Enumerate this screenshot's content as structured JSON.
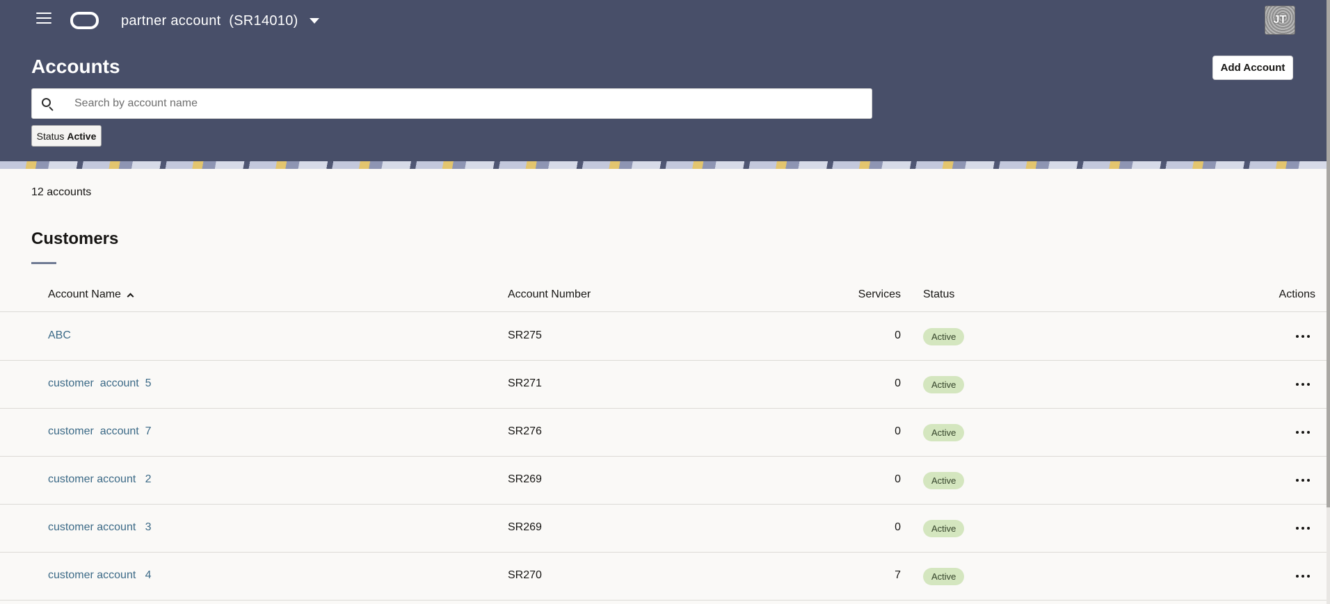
{
  "header": {
    "account_switcher_label": "partner account  (SR14010)",
    "avatar_initials": "JT",
    "page_title": "Accounts",
    "add_account_label": "Add Account",
    "search": {
      "placeholder": "Search by account name",
      "value": ""
    },
    "filter_chip": {
      "label": "Status",
      "value": "Active"
    }
  },
  "content": {
    "count_text": "12 accounts",
    "section_title": "Customers",
    "columns": {
      "name": "Account Name",
      "number": "Account Number",
      "services": "Services",
      "status": "Status",
      "actions": "Actions"
    },
    "rows": [
      {
        "name": "ABC",
        "number": "SR275",
        "services": "0",
        "status": "Active"
      },
      {
        "name": "customer  account  5",
        "number": "SR271",
        "services": "0",
        "status": "Active"
      },
      {
        "name": "customer  account  7",
        "number": "SR276",
        "services": "0",
        "status": "Active"
      },
      {
        "name": "customer account   2",
        "number": "SR269",
        "services": "0",
        "status": "Active"
      },
      {
        "name": "customer account   3",
        "number": "SR269",
        "services": "0",
        "status": "Active"
      },
      {
        "name": "customer account   4",
        "number": "SR270",
        "services": "7",
        "status": "Active"
      }
    ]
  },
  "colors": {
    "header_bg": "#484f69",
    "link": "#3c6a87",
    "status_badge_bg": "#d4e6bf"
  },
  "icons": [
    "hamburger-menu-icon",
    "oracle-logo-icon",
    "caret-down-icon",
    "search-icon",
    "sort-ascending-icon",
    "more-actions-icon"
  ]
}
